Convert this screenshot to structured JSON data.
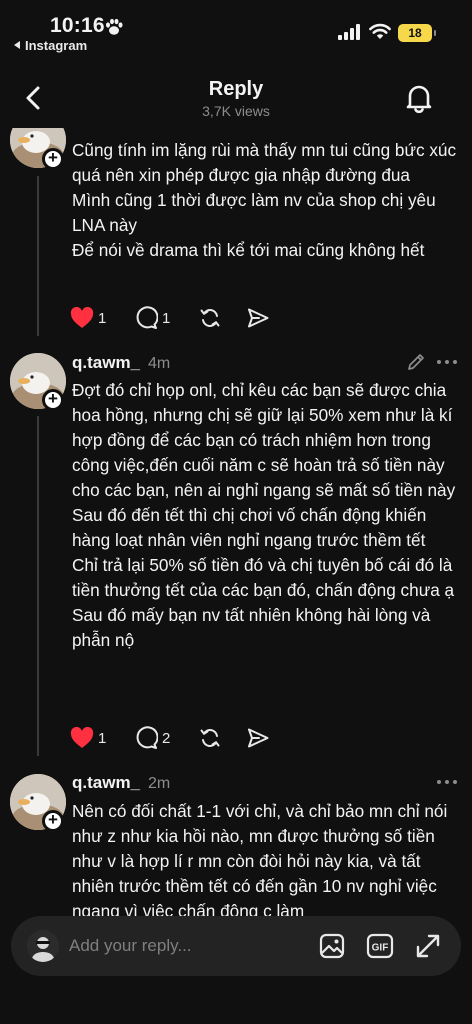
{
  "status_bar": {
    "time": "10:16",
    "back_app": "Instagram",
    "battery": "18",
    "battery_color": "#f6d84a"
  },
  "header": {
    "title": "Reply",
    "subtitle": "3,7K views"
  },
  "posts": [
    {
      "username": "",
      "time": "",
      "paragraphs": [
        "Cũng tính im lặng rùi mà thấy mn tui cũng bức xúc quá nên xin phép được gia nhập đường đua",
        "Mình cũng 1 thời được làm nv của shop chị yêu LNA này",
        "Để nói về drama thì kể tới mai cũng không hết"
      ],
      "likes": "1",
      "comments": "1"
    },
    {
      "username": "q.tawm_",
      "time": "4m",
      "paragraphs": [
        "Đợt đó chỉ họp onl, chỉ kêu các bạn sẽ được chia hoa hồng, nhưng chị sẽ giữ lại 50% xem như là kí hợp đồng để các bạn có trách nhiệm hơn trong công việc,đến cuối năm c sẽ hoàn trả số tiền này cho các bạn, nên ai nghỉ ngang sẽ mất số tiền này",
        "Sau đó đến tết thì chị chơi vố chấn động khiến hàng loạt nhân viên nghỉ ngang trước thềm tết",
        "Chỉ trả lại 50% số tiền đó và chị tuyên bố cái đó là tiền thưởng tết của các bạn đó, chấn động chưa ạ",
        "Sau đó mấy bạn nv tất nhiên không hài lòng và phẫn nộ"
      ],
      "likes": "1",
      "comments": "2"
    },
    {
      "username": "q.tawm_",
      "time": "2m",
      "paragraphs": [
        "Nên có đối chất 1-1 với chỉ, và chỉ bảo mn chỉ nói như z như kia hồi nào, mn được thưởng số tiền như v là hợp lí r mn còn đòi hỏi này kia, và tất nhiên trước thềm tết có đến gần 10 nv nghỉ việc ngang vì việc chấn động c làm"
      ]
    }
  ],
  "reply_bar": {
    "placeholder": "Add your reply..."
  },
  "icons": {
    "like": "heart-filled-icon",
    "comment": "comment-bubble-icon",
    "repost": "repost-icon",
    "share": "send-icon",
    "back": "chevron-left-icon",
    "notifications": "bell-icon",
    "image": "image-icon",
    "gif": "gif-icon",
    "expand": "expand-icon"
  },
  "colors": {
    "background": "#101010",
    "like_red": "#ff3040",
    "muted_text": "#8c8c8c"
  }
}
